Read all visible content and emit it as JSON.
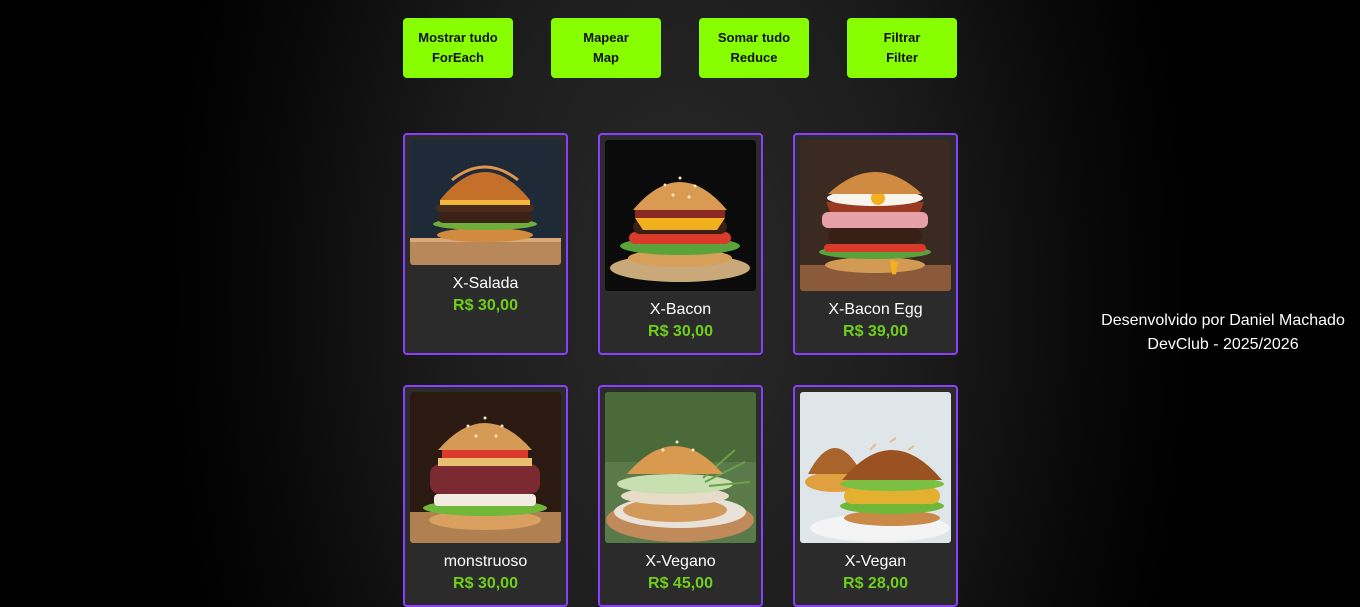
{
  "buttons": [
    {
      "line1": "Mostrar tudo",
      "line2": "ForEach"
    },
    {
      "line1": "Mapear",
      "line2": "Map"
    },
    {
      "line1": "Somar tudo",
      "line2": "Reduce"
    },
    {
      "line1": "Filtrar",
      "line2": "Filter"
    }
  ],
  "products": [
    {
      "name": "X-Salada",
      "price": "R$ 30,00"
    },
    {
      "name": "X-Bacon",
      "price": "R$ 30,00"
    },
    {
      "name": "X-Bacon Egg",
      "price": "R$ 39,00"
    },
    {
      "name": "monstruoso",
      "price": "R$ 30,00"
    },
    {
      "name": "X-Vegano",
      "price": "R$ 45,00"
    },
    {
      "name": "X-Vegan",
      "price": "R$ 28,00"
    }
  ],
  "footer": {
    "line1": "Desenvolvido por Daniel Machado",
    "line2": "DevClub - 2025/2026"
  },
  "colors": {
    "button": "#88ff00",
    "card_border": "#8a3ffc",
    "price": "#6fcf1a"
  }
}
